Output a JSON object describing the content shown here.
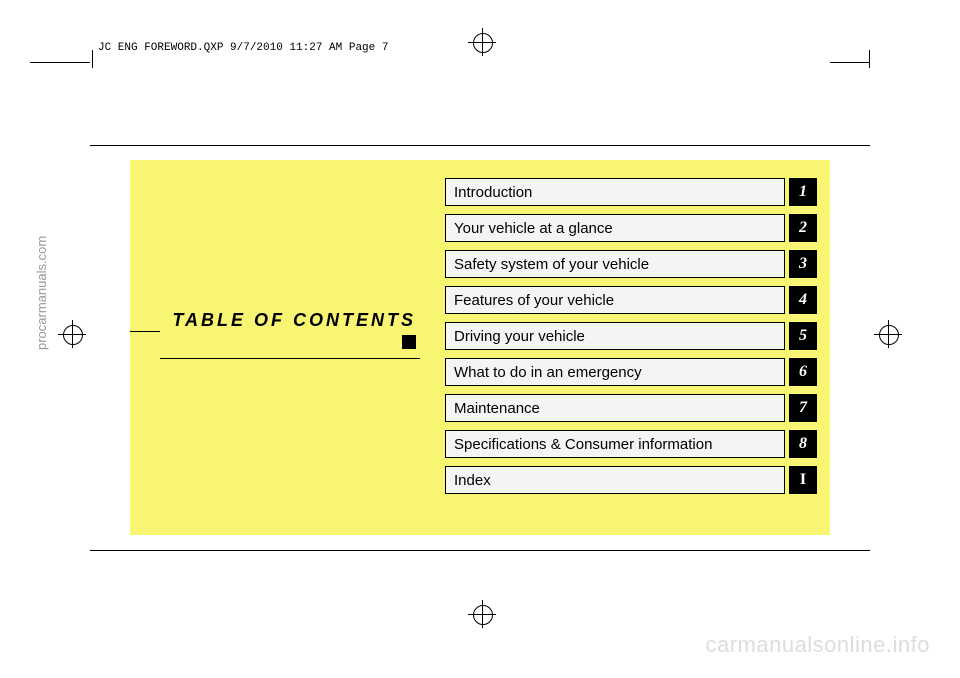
{
  "sidebar": "procarmanuals.com",
  "footer": "carmanualsonline.info",
  "header": "JC ENG FOREWORD.QXP  9/7/2010  11:27 AM  Page 7",
  "toc_title": "TABLE OF CONTENTS",
  "toc": [
    {
      "label": "Introduction",
      "num": "1"
    },
    {
      "label": "Your vehicle at a glance",
      "num": "2"
    },
    {
      "label": "Safety system of your vehicle",
      "num": "3"
    },
    {
      "label": "Features of your vehicle",
      "num": "4"
    },
    {
      "label": "Driving your vehicle",
      "num": "5"
    },
    {
      "label": "What to do in an emergency",
      "num": "6"
    },
    {
      "label": "Maintenance",
      "num": "7"
    },
    {
      "label": "Specifications & Consumer information",
      "num": "8"
    },
    {
      "label": "Index",
      "num": "I"
    }
  ]
}
